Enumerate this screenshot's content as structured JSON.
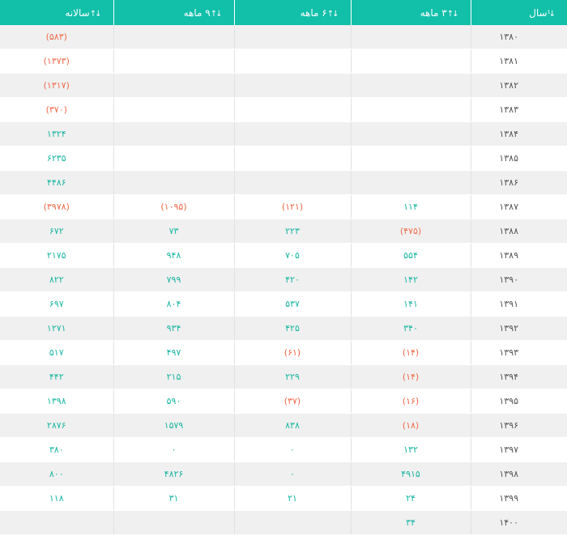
{
  "headers": [
    {
      "label": "سال",
      "sort_icon": "sort-numeric-icon"
    },
    {
      "label": "۳ ماهه",
      "sort_icon": "sort-arrows-icon"
    },
    {
      "label": "۶ ماهه",
      "sort_icon": "sort-arrows-icon"
    },
    {
      "label": "۹ ماهه",
      "sort_icon": "sort-arrows-icon"
    },
    {
      "label": "سالانه",
      "sort_icon": "sort-arrows-icon"
    }
  ],
  "colors": {
    "header": "#12bfa9",
    "positive": "#19b6a3",
    "negative": "#f06a4a"
  },
  "rows": [
    {
      "year": "۱۳۸۰",
      "m3": "",
      "m6": "",
      "m9": "",
      "annual": "(۵۸۳)"
    },
    {
      "year": "۱۳۸۱",
      "m3": "",
      "m6": "",
      "m9": "",
      "annual": "(۱۳۷۳)"
    },
    {
      "year": "۱۳۸۲",
      "m3": "",
      "m6": "",
      "m9": "",
      "annual": "(۱۳۱۷)"
    },
    {
      "year": "۱۳۸۳",
      "m3": "",
      "m6": "",
      "m9": "",
      "annual": "(۳۷۰)"
    },
    {
      "year": "۱۳۸۴",
      "m3": "",
      "m6": "",
      "m9": "",
      "annual": "۱۳۲۴"
    },
    {
      "year": "۱۳۸۵",
      "m3": "",
      "m6": "",
      "m9": "",
      "annual": "۶۲۳۵"
    },
    {
      "year": "۱۳۸۶",
      "m3": "",
      "m6": "",
      "m9": "",
      "annual": "۴۴۸۶"
    },
    {
      "year": "۱۳۸۷",
      "m3": "۱۱۴",
      "m6": "(۱۲۱)",
      "m9": "(۱۰۹۵)",
      "annual": "(۳۹۷۸)"
    },
    {
      "year": "۱۳۸۸",
      "m3": "(۴۷۵)",
      "m6": "۲۲۳",
      "m9": "۷۳",
      "annual": "۶۷۲"
    },
    {
      "year": "۱۳۸۹",
      "m3": "۵۵۴",
      "m6": "۷۰۵",
      "m9": "۹۴۸",
      "annual": "۲۱۷۵"
    },
    {
      "year": "۱۳۹۰",
      "m3": "۱۴۲",
      "m6": "۴۲۰",
      "m9": "۷۹۹",
      "annual": "۸۲۲"
    },
    {
      "year": "۱۳۹۱",
      "m3": "۱۴۱",
      "m6": "۵۳۷",
      "m9": "۸۰۴",
      "annual": "۶۹۷"
    },
    {
      "year": "۱۳۹۲",
      "m3": "۳۴۰",
      "m6": "۴۲۵",
      "m9": "۹۳۴",
      "annual": "۱۲۷۱"
    },
    {
      "year": "۱۳۹۳",
      "m3": "(۱۴)",
      "m6": "(۶۱)",
      "m9": "۴۹۷",
      "annual": "۵۱۷"
    },
    {
      "year": "۱۳۹۴",
      "m3": "(۱۴)",
      "m6": "۲۲۹",
      "m9": "۲۱۵",
      "annual": "۴۴۲"
    },
    {
      "year": "۱۳۹۵",
      "m3": "(۱۶)",
      "m6": "(۳۷)",
      "m9": "۵۹۰",
      "annual": "۱۳۹۸"
    },
    {
      "year": "۱۳۹۶",
      "m3": "(۱۸)",
      "m6": "۸۳۸",
      "m9": "۱۵۷۹",
      "annual": "۲۸۷۶"
    },
    {
      "year": "۱۳۹۷",
      "m3": "۱۳۲",
      "m6": "۰",
      "m9": "۰",
      "annual": "۳۸۰"
    },
    {
      "year": "۱۳۹۸",
      "m3": "۴۹۱۵",
      "m6": "۰",
      "m9": "۴۸۲۶",
      "annual": "۸۰۰"
    },
    {
      "year": "۱۳۹۹",
      "m3": "۲۴",
      "m6": "۲۱",
      "m9": "۳۱",
      "annual": "۱۱۸"
    },
    {
      "year": "۱۴۰۰",
      "m3": "۳۴",
      "m6": "",
      "m9": "",
      "annual": ""
    }
  ]
}
